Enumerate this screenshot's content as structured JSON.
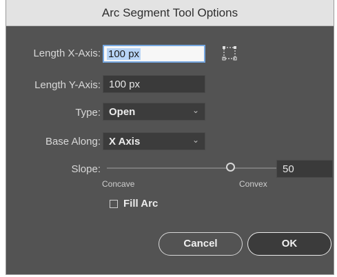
{
  "dialog": {
    "title": "Arc Segment Tool Options",
    "length_x": {
      "label": "Length X-Axis:",
      "value": "100 px"
    },
    "length_y": {
      "label": "Length Y-Axis:",
      "value": "100 px"
    },
    "type": {
      "label": "Type:",
      "value": "Open"
    },
    "base_along": {
      "label": "Base Along:",
      "value": "X Axis"
    },
    "slope": {
      "label": "Slope:",
      "value": "50",
      "min_label": "Concave",
      "max_label": "Convex",
      "position_fraction": 0.5
    },
    "fill_arc": {
      "label": "Fill Arc",
      "checked": false
    },
    "buttons": {
      "cancel": "Cancel",
      "ok": "OK"
    }
  }
}
